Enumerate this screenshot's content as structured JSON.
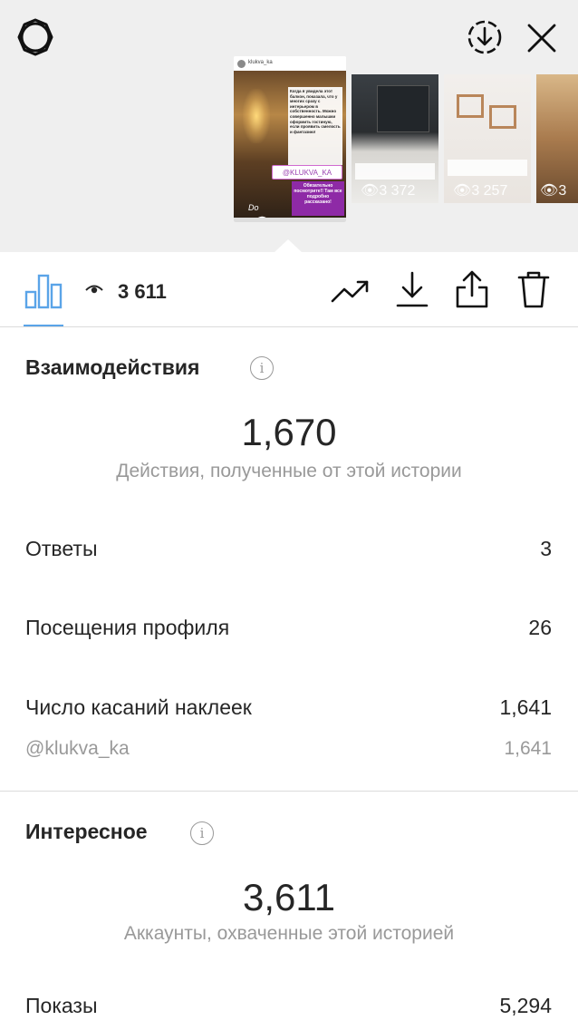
{
  "header": {
    "settings_icon": "gear-icon",
    "save_icon": "download-circle-icon",
    "close_icon": "close-icon"
  },
  "stories": {
    "main": {
      "username": "klukva_ka",
      "caption": "Когда я увидела этот балкон, показала, что у многих сразу с интерьером в собственность. Можно совершенно малышки оформить гостиную, если проявить смелость и фантазию!",
      "tag": "@KLUKVA_KA",
      "promo": "Обязательно посмотрите!! Там все подробно рассказано!",
      "signature": "Do",
      "views": "3 611"
    },
    "others": [
      {
        "views": "3 372"
      },
      {
        "views": "3 257"
      },
      {
        "views": "3"
      }
    ]
  },
  "toolbar": {
    "views_count": "3 611",
    "icons": [
      "insights-bar-chart-icon",
      "eye-icon",
      "promote-trend-icon",
      "download-icon",
      "share-icon",
      "trash-icon"
    ]
  },
  "interactions": {
    "title": "Взаимодействия",
    "total": "1,670",
    "total_caption": "Действия, полученные от этой истории",
    "rows": [
      {
        "label": "Ответы",
        "value": "3"
      },
      {
        "label": "Посещения профиля",
        "value": "26"
      },
      {
        "label": "Число касаний наклеек",
        "value": "1,641"
      },
      {
        "label": "@klukva_ka",
        "value": "1,641"
      }
    ]
  },
  "discovery": {
    "title": "Интересное",
    "total": "3,611",
    "total_caption": "Аккаунты, охваченные этой историей",
    "rows": [
      {
        "label": "Показы",
        "value": "5,294"
      }
    ]
  },
  "colors": {
    "accent": "#5aa4e8",
    "text": "#262626",
    "muted": "#999999",
    "top_bg": "#efefef"
  }
}
